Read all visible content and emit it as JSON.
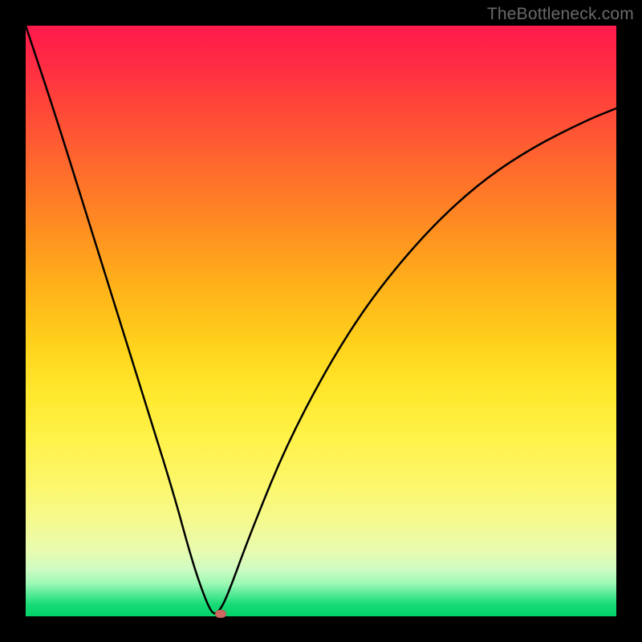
{
  "watermark": "TheBottleneck.com",
  "chart_data": {
    "type": "line",
    "title": "",
    "xlabel": "",
    "ylabel": "",
    "x_range": [
      0,
      100
    ],
    "y_range": [
      0,
      100
    ],
    "series": [
      {
        "name": "bottleneck-curve",
        "x": [
          0,
          5,
          10,
          15,
          20,
          25,
          28,
          30,
          31.5,
          32.5,
          34,
          38,
          45,
          55,
          65,
          75,
          85,
          95,
          100
        ],
        "y": [
          100,
          85,
          69,
          53,
          37,
          21,
          10,
          4,
          0.5,
          0.5,
          3,
          14,
          31,
          49,
          62,
          72,
          79,
          84,
          86
        ]
      }
    ],
    "min_point": {
      "x": 32,
      "y": 0.5
    },
    "marker": {
      "x": 33,
      "y": 0,
      "color": "#cf6a63"
    },
    "gradient_stops": [
      {
        "offset": 0,
        "color": "#ff1a4d"
      },
      {
        "offset": 50,
        "color": "#ffd000"
      },
      {
        "offset": 90,
        "color": "#f5fa90"
      },
      {
        "offset": 100,
        "color": "#02d268"
      }
    ]
  }
}
